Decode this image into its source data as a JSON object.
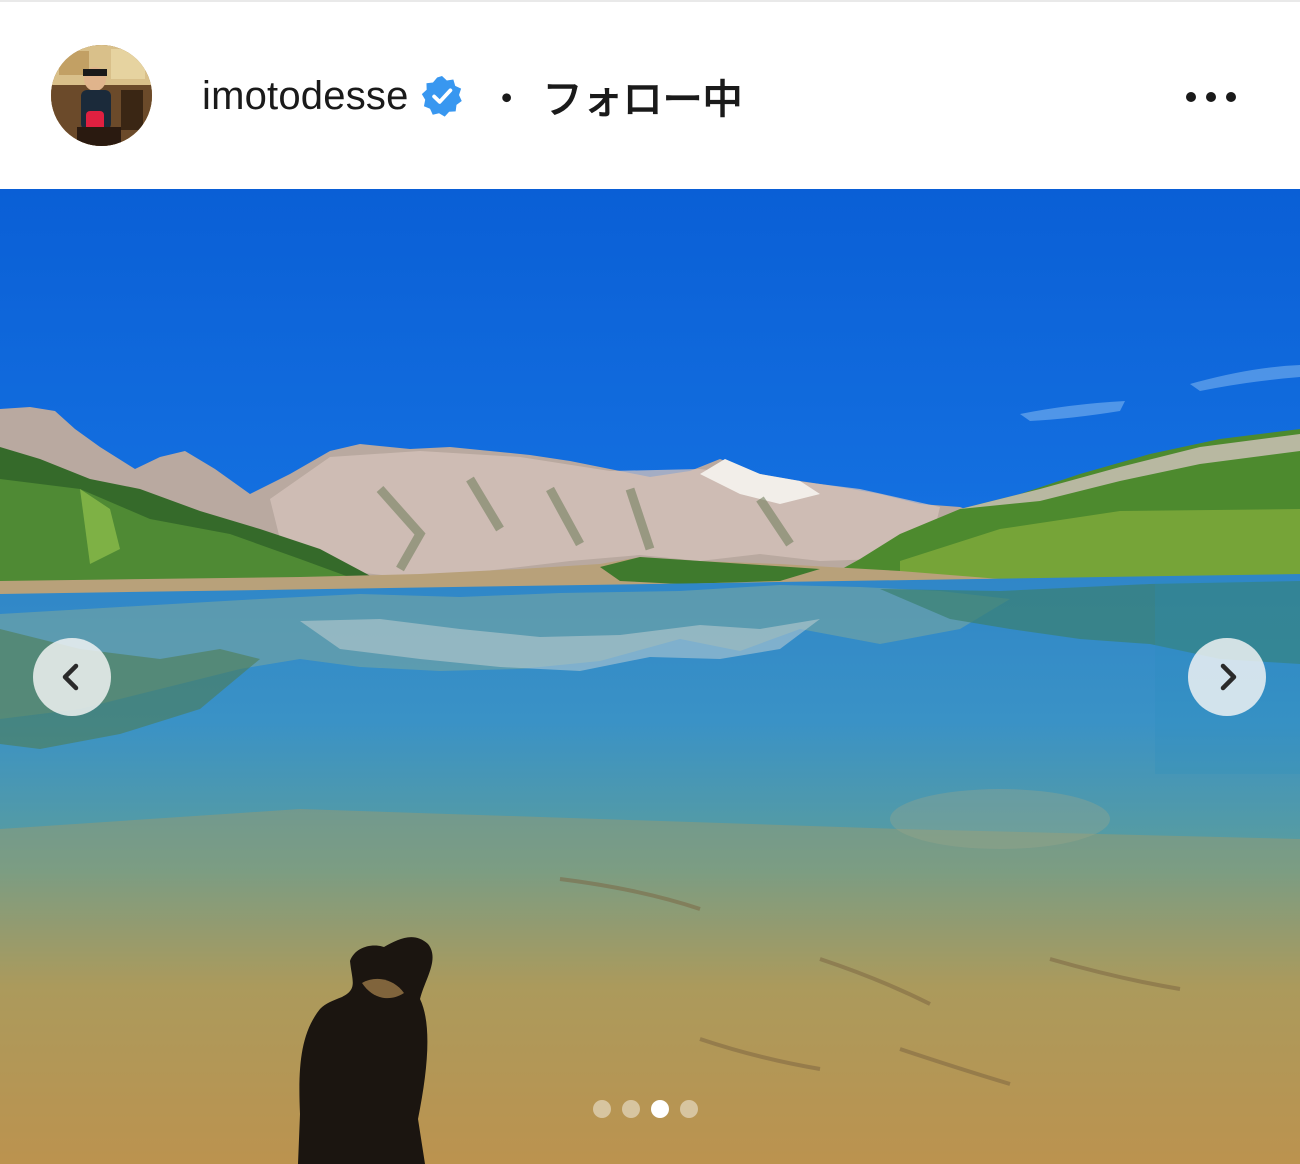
{
  "header": {
    "username": "imotodesse",
    "separator": "・",
    "follow_status": "フォロー中"
  },
  "icons": {
    "verified": "verified-badge-icon",
    "more": "more-options-icon",
    "prev": "chevron-left-icon",
    "next": "chevron-right-icon"
  },
  "carousel": {
    "total_slides": 4,
    "active_index": 2
  },
  "colors": {
    "verified_blue": "#3897f0",
    "text": "#1a1a1a"
  }
}
